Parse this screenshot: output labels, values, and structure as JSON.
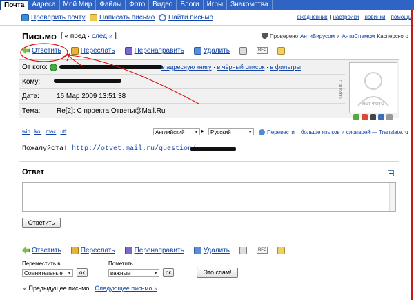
{
  "tabs": [
    "Почта",
    "Адреса",
    "Мой Мир",
    "Файлы",
    "Фото",
    "Видео",
    "Блоги",
    "Игры",
    "Знакомства"
  ],
  "action_row": {
    "check_mail": "Проверить почту",
    "write_letter": "Написать письмо",
    "find_letter": "Найти письмо",
    "right_links": [
      "ежедневник",
      "настройки",
      "новинки",
      "помощь"
    ],
    "separator": "|"
  },
  "title": "Письмо",
  "nav": {
    "prefix": "[ « пред ·",
    "next": "след »",
    "suffix": "]"
  },
  "verified": {
    "text1": "Проверено",
    "antivirus": "АнтиВирусом",
    "and": "и",
    "antispam": "АнтиСпамом",
    "text2": "Касперского"
  },
  "toolbar": {
    "reply": "Ответить",
    "forward": "Переслать",
    "redirect": "Перенаправить",
    "delete": "Удалить",
    "rfc": "RFC"
  },
  "header": {
    "from_label": "От кого:",
    "from_links": [
      "в адресную книгу",
      "в чёрный список",
      "в фильтры"
    ],
    "to_label": "Кому:",
    "date_label": "Дата:",
    "date_value": "16 Мар 2009 13:51:38",
    "subject_label": "Тема:",
    "subject_value": "Re[2]: С проекта Ответы@Mail.Ru",
    "hide_label": "скрыть ↓",
    "photo_label": "НЕТ ФОТО"
  },
  "encodings": [
    "win",
    "koi",
    "mac",
    "utf"
  ],
  "translate": {
    "from_lang": "Английский",
    "to_lang": "Русский",
    "button": "Перевести",
    "more": "больше языков и словарей — Translate.ru"
  },
  "body": {
    "text": "Пожалуйста!",
    "link": "http://otvet.mail.ru/question/"
  },
  "reply": {
    "heading": "Ответ",
    "button": "Ответить"
  },
  "bottom": {
    "move_label": "Переместить в",
    "move_value": "Сомнительные",
    "mark_label": "Пометить",
    "mark_value": "важным",
    "ok": "ок",
    "spam_button": "Это спам!",
    "prev_letter": "« Предыдущее письмо",
    "next_letter": "Следующее письмо »",
    "separator": "·"
  },
  "colors": {
    "tabbar": "#2f63c4",
    "link": "#1144aa",
    "annotation": "#e01010"
  }
}
